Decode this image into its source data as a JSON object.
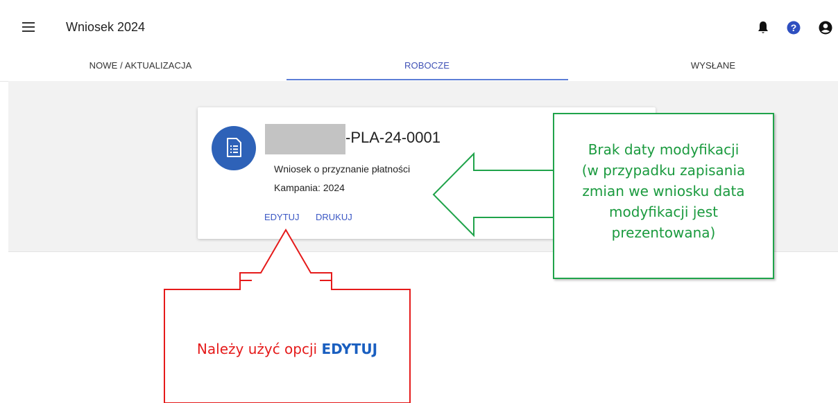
{
  "header": {
    "title": "Wniosek 2024",
    "icons": [
      "menu-icon",
      "bell-icon",
      "help-icon",
      "account-icon"
    ]
  },
  "tabs": [
    {
      "label": "NOWE / AKTUALIZACJA",
      "active": false
    },
    {
      "label": "ROBOCZE",
      "active": true
    },
    {
      "label": "WYSŁANE",
      "active": false
    }
  ],
  "card": {
    "icon": "document-icon",
    "title": "-PLA-24-0001",
    "type": "Wniosek o przyznanie płatności",
    "campaign": "Kampania: 2024",
    "actions": {
      "edit": "EDYTUJ",
      "print": "DRUKUJ"
    }
  },
  "annotations": {
    "green_callout": [
      "Brak daty modyfikacji",
      "(w przypadku zapisania",
      "zmian we wniosku data",
      "modyfikacji jest",
      "prezentowana)"
    ],
    "red_callout": {
      "text": "Należy użyć opcji ",
      "highlight": "EDYTUJ"
    }
  },
  "colors": {
    "accent": "#3f51b5",
    "avatar": "#2e62b8",
    "green": "#1a9a3e",
    "red": "#e51a1a",
    "highlight_blue": "#1a5fc0"
  }
}
